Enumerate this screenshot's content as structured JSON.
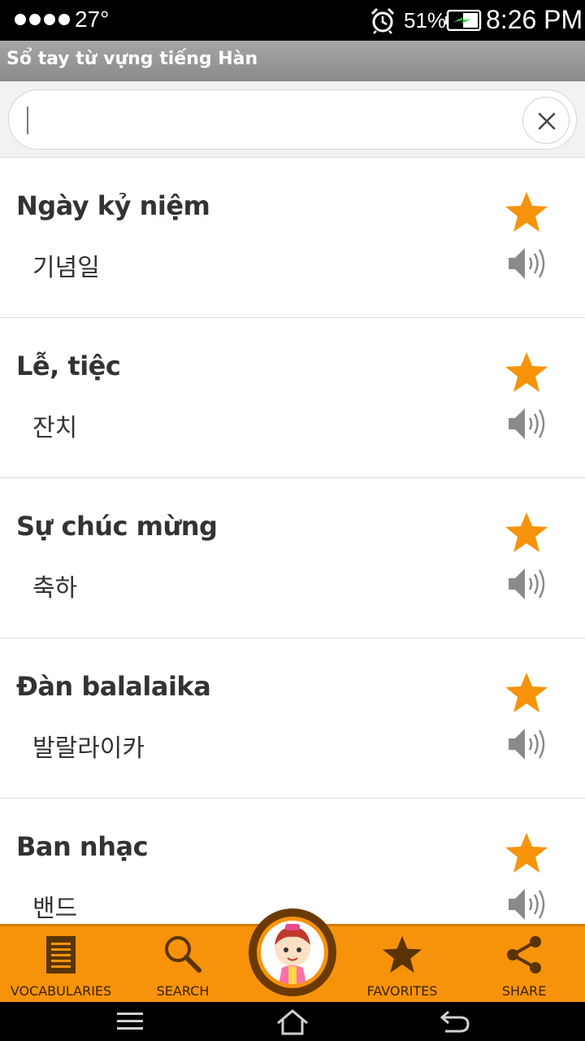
{
  "status_bar": {
    "temperature": "27°",
    "battery_percent": "51%",
    "time": "8:26 PM"
  },
  "app_bar": {
    "title": "Sổ tay từ vựng tiếng Hàn"
  },
  "search": {
    "value": "",
    "placeholder": ""
  },
  "vocab_items": [
    {
      "vietnamese": "Ngày kỷ niệm",
      "korean": "기념일",
      "favorite": true
    },
    {
      "vietnamese": "Lễ, tiệc",
      "korean": "잔치",
      "favorite": true
    },
    {
      "vietnamese": "Sự chúc mừng",
      "korean": "축하",
      "favorite": true
    },
    {
      "vietnamese": "Đàn balalaika",
      "korean": "발랄라이카",
      "favorite": true
    },
    {
      "vietnamese": "Ban nhạc",
      "korean": "밴드",
      "favorite": true
    }
  ],
  "tabs": [
    {
      "label": "VOCABULARIES",
      "icon": "book-icon"
    },
    {
      "label": "SEARCH",
      "icon": "search-icon"
    },
    {
      "label": "FAVORITES",
      "icon": "star-icon"
    },
    {
      "label": "SHARE",
      "icon": "share-icon"
    }
  ],
  "colors": {
    "accent": "#f7930a",
    "star": "#f7930a",
    "app_bar": "#999999"
  }
}
